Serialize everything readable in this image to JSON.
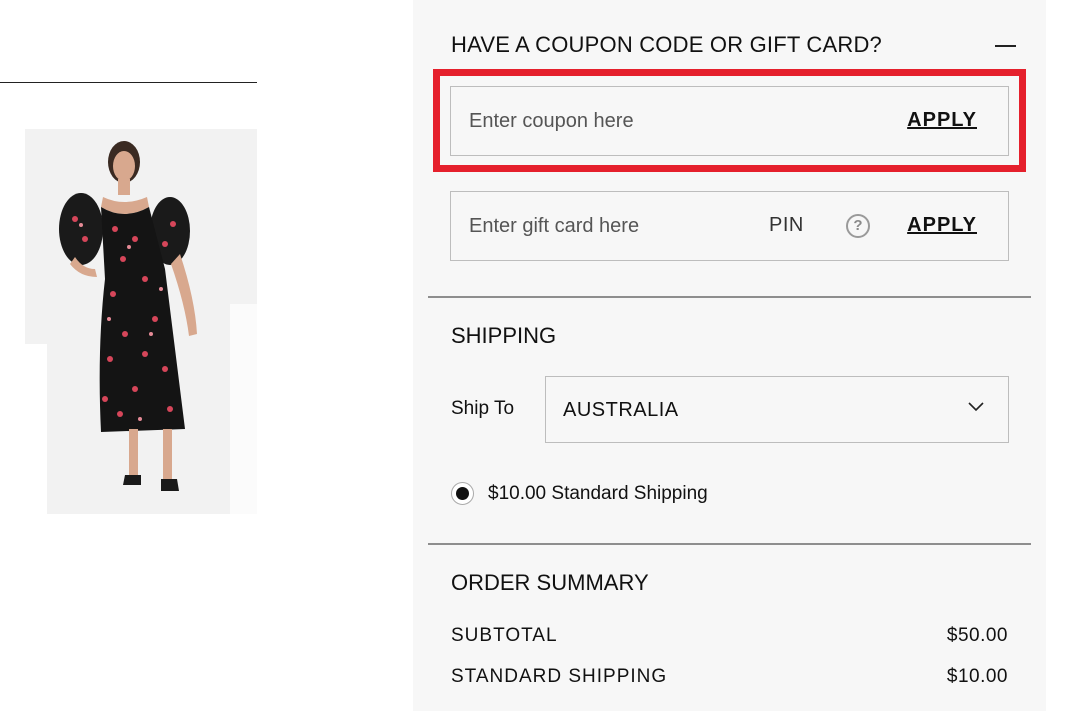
{
  "coupon_section": {
    "title": "HAVE A COUPON CODE OR GIFT CARD?",
    "coupon_placeholder": "Enter coupon here",
    "coupon_apply_label": "APPLY",
    "giftcard_placeholder": "Enter gift card here",
    "pin_label": "PIN",
    "help_icon_glyph": "?",
    "giftcard_apply_label": "APPLY"
  },
  "shipping": {
    "title": "SHIPPING",
    "ship_to_label": "Ship To",
    "country_selected": "AUSTRALIA",
    "options": [
      {
        "label": "$10.00 Standard Shipping",
        "selected": true
      }
    ]
  },
  "order_summary": {
    "title": "ORDER SUMMARY",
    "rows": [
      {
        "label": "SUBTOTAL",
        "value": "$50.00"
      },
      {
        "label": "STANDARD SHIPPING",
        "value": "$10.00"
      }
    ]
  },
  "colors": {
    "highlight": "#e5202c",
    "panel_background": "#f7f7f7"
  },
  "icons": [
    "collapse-icon",
    "help-icon",
    "chevron-down-icon"
  ],
  "product_image": {
    "description": ""
  }
}
